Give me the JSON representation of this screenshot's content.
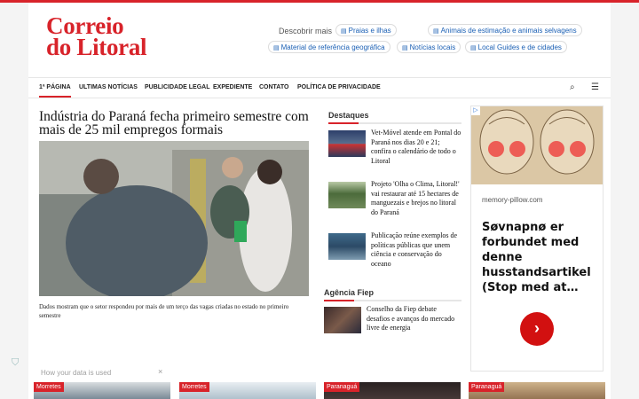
{
  "logo": {
    "line1": "Correio",
    "line2": "do Litoral"
  },
  "discover": {
    "label": "Descobrir mais",
    "chips": [
      "Praias e ilhas",
      "Animais de estimação e animais selvagens",
      "Material de referência geográfica",
      "Notícias locais",
      "Local Guides e de cidades"
    ]
  },
  "nav": {
    "items": [
      "1ª Página",
      "Ultimas Notícias",
      "Publicidade Legal",
      "Expediente",
      "Contato",
      "Política de Privacidade"
    ],
    "search_icon": "⌕",
    "menu_icon": "☰"
  },
  "main_article": {
    "title": "Indústria do Paraná fecha primeiro semestre com mais de 25 mil empregos formais",
    "caption": "Dados mostram que o setor respondeu por mais de um terço das vagas criadas no estado no primeiro semestre"
  },
  "destaques": {
    "title": "Destaques",
    "items": [
      {
        "text": "Vet-Móvel atende em Pontal do Paraná nos dias 20 e 21; confira o calendário de todo o Litoral"
      },
      {
        "text": "Projeto 'Olha o Clima, Litoral!' vai restaurar até 15 hectares de manguezais e brejos no litoral do Paraná"
      },
      {
        "text": "Publicação reúne exemplos de políticas públicas que unem ciência e conservação do oceano"
      }
    ]
  },
  "agencia": {
    "title": "Agência Fiep",
    "items": [
      {
        "text": "Conselho da Fiep debate desafios e avanços do mercado livre de energia"
      }
    ]
  },
  "ad": {
    "flag": "▷",
    "site": "memory-pillow.com",
    "headline": "Søvnapnø er forbundet med denne husstandsartikel (Stop med at…",
    "cta": "›"
  },
  "privacy": {
    "text": "How your data is used",
    "close": "×",
    "shield": "⛉"
  },
  "bottom_cards": [
    {
      "tag": "Morretes",
      "color": "#6b7d8a"
    },
    {
      "tag": "Morretes",
      "color": "#a7b9c6"
    },
    {
      "tag": "Paranaguá",
      "color": "#4a3c3a"
    },
    {
      "tag": "Paranaguá",
      "color": "#8b6a4a"
    }
  ]
}
